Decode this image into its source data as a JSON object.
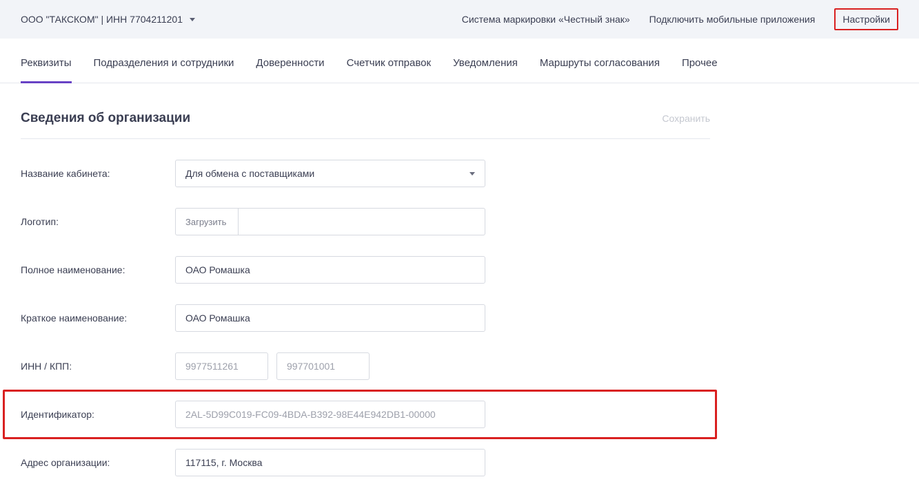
{
  "header": {
    "org_label": "ООО \"ТАКСКОМ\" | ИНН 7704211201",
    "links": {
      "marking_system": "Система маркировки «Честный знак»",
      "mobile_apps": "Подключить мобильные приложения",
      "settings": "Настройки"
    }
  },
  "tabs": {
    "requisites": "Реквизиты",
    "divisions": "Подразделения и сотрудники",
    "powers": "Доверенности",
    "counter": "Счетчик отправок",
    "notifications": "Уведомления",
    "routes": "Маршруты согласования",
    "other": "Прочее"
  },
  "section": {
    "title": "Сведения об организации",
    "save_label": "Сохранить"
  },
  "form": {
    "cabinet_name": {
      "label": "Название кабинета:",
      "value": "Для обмена с поставщиками"
    },
    "logo": {
      "label": "Логотип:",
      "upload_button": "Загрузить"
    },
    "full_name": {
      "label": "Полное наименование:",
      "value": "ОАО Ромашка"
    },
    "short_name": {
      "label": "Краткое наименование:",
      "value": "ОАО Ромашка"
    },
    "inn_kpp": {
      "label": "ИНН / КПП:",
      "inn": "9977511261",
      "kpp": "997701001"
    },
    "identifier": {
      "label": "Идентификатор:",
      "value": "2AL-5D99C019-FC09-4BDA-B392-98E44E942DB1-00000"
    },
    "org_address": {
      "label": "Адрес организации:",
      "value": "117115, г. Москва"
    }
  }
}
